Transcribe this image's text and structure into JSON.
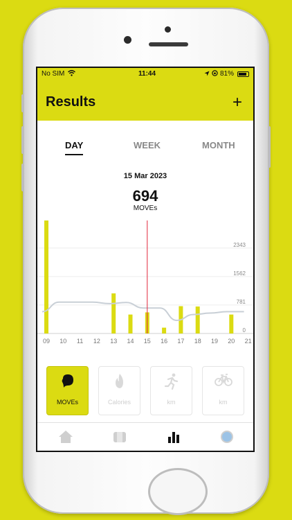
{
  "status": {
    "carrier": "No SIM",
    "time": "11:44",
    "battery": "81%"
  },
  "header": {
    "title": "Results",
    "add_label": "+"
  },
  "tabs": [
    {
      "label": "DAY",
      "active": true
    },
    {
      "label": "WEEK",
      "active": false
    },
    {
      "label": "MONTH",
      "active": false
    }
  ],
  "summary": {
    "date": "15 Mar 2023",
    "value": "694",
    "unit": "MOVEs"
  },
  "chart_data": {
    "type": "bar",
    "categories": [
      "09",
      "10",
      "11",
      "12",
      "13",
      "14",
      "15",
      "16",
      "17",
      "18",
      "19",
      "20",
      "21"
    ],
    "values": [
      3330,
      0,
      0,
      0,
      1100,
      520,
      580,
      160,
      750,
      740,
      0,
      520,
      0
    ],
    "y_ticks": [
      "0",
      "781",
      "1562",
      "2343"
    ],
    "ylim": [
      0,
      3100
    ],
    "selected_category": "15",
    "bar_color": "#dbdb12",
    "line_color": "#c8cfd6",
    "marker_color": "#e0263c",
    "trend_series": {
      "values": [
        600,
        860,
        860,
        860,
        820,
        850,
        700,
        700,
        360,
        520,
        560,
        600,
        600
      ]
    }
  },
  "metrics": [
    {
      "label": "MOVEs",
      "icon": "moves-icon",
      "active": true
    },
    {
      "label": "Calories",
      "icon": "flame-icon",
      "active": false
    },
    {
      "label": "km",
      "icon": "runner-icon",
      "active": false
    },
    {
      "label": "km",
      "icon": "bicycle-icon",
      "active": false
    }
  ],
  "nav": [
    {
      "icon": "home-icon",
      "active": false
    },
    {
      "icon": "device-icon",
      "active": false
    },
    {
      "icon": "bar-chart-icon",
      "active": true
    },
    {
      "icon": "avatar-icon",
      "active": false
    }
  ],
  "colors": {
    "accent": "#dbdb12",
    "text": "#111111",
    "muted": "#888888"
  }
}
